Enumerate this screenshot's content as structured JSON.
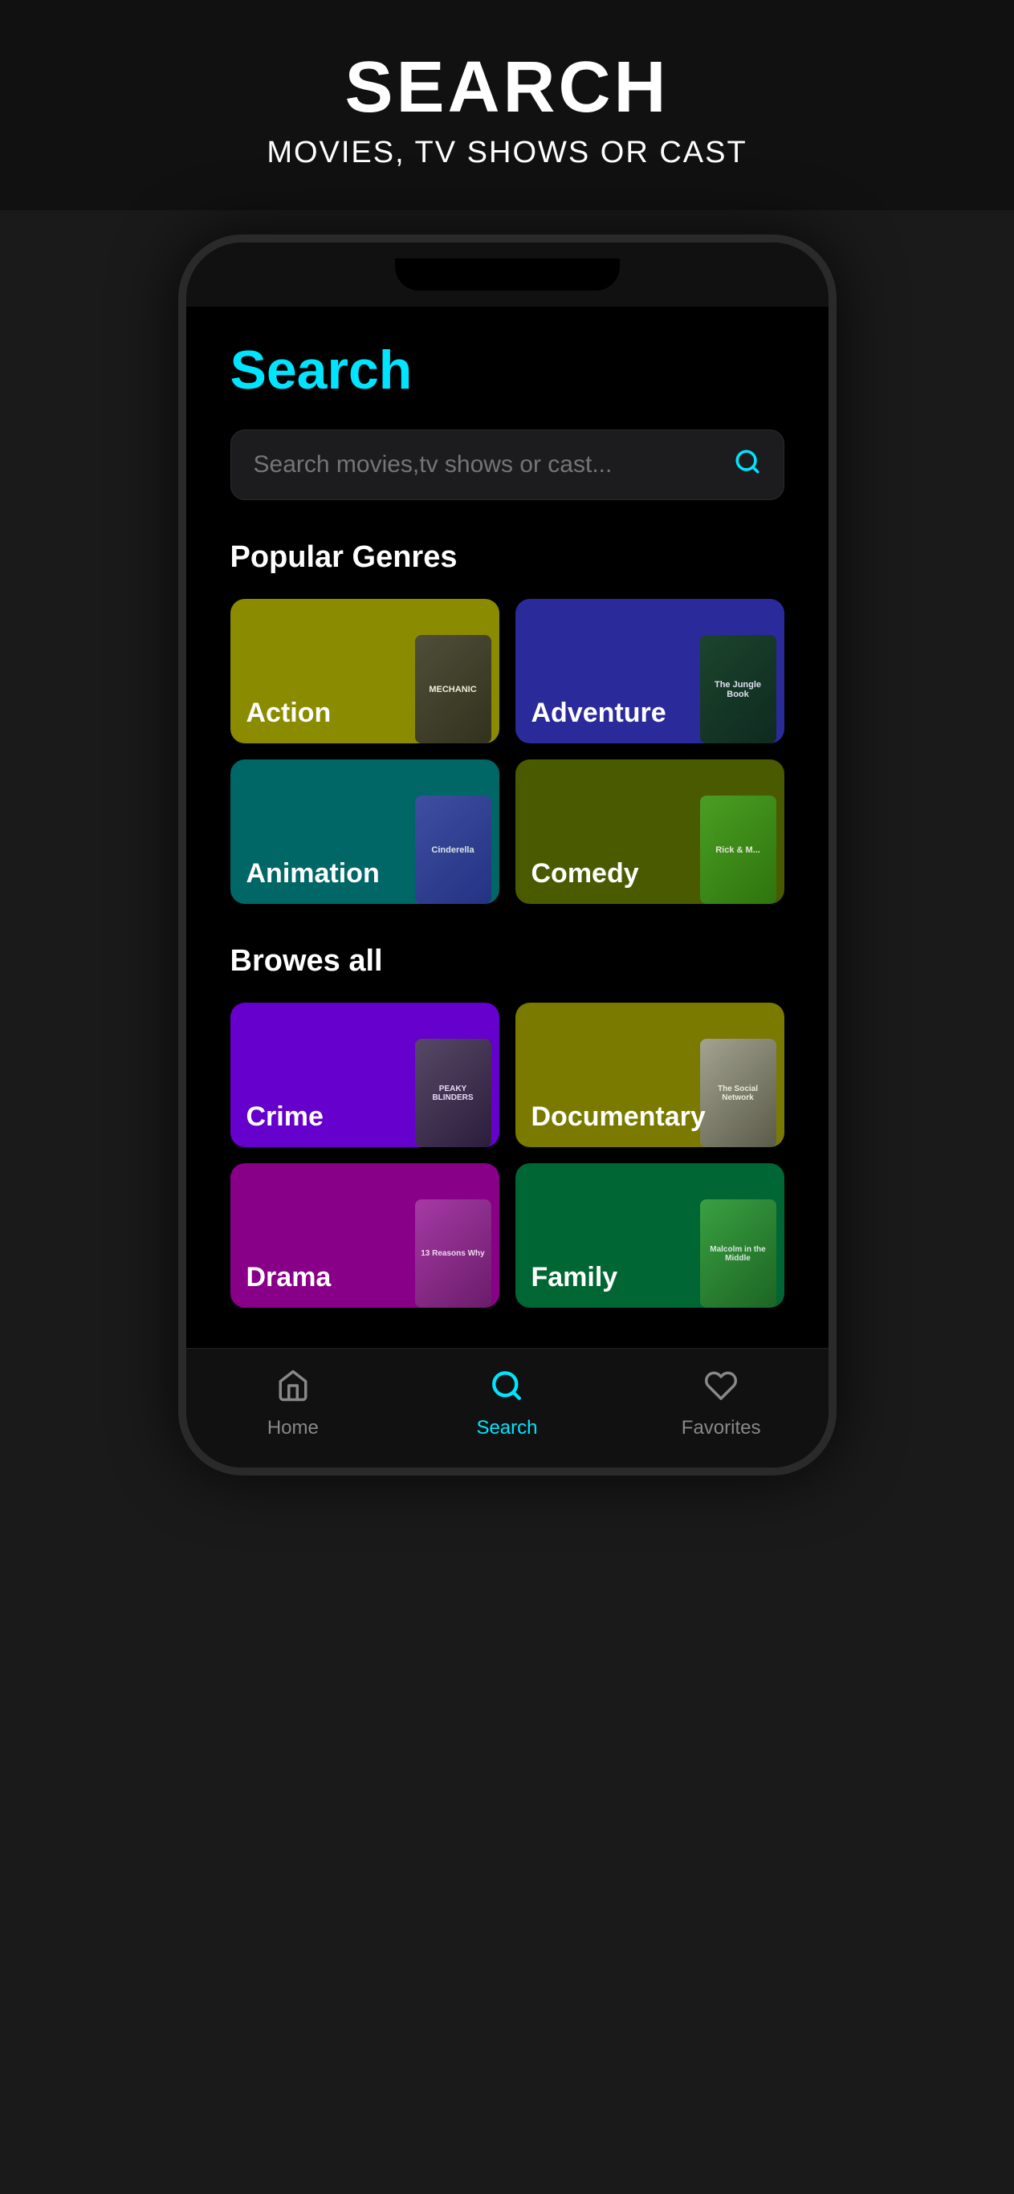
{
  "header": {
    "title": "SEARCH",
    "subtitle": "MOVIES, TV SHOWS OR CAST"
  },
  "screen": {
    "search_title": "Search",
    "search_placeholder": "Search movies,tv shows or cast...",
    "popular_genres_title": "Popular Genres",
    "browse_all_title": "Browes all",
    "genres_popular": [
      {
        "id": "action",
        "label": "Action",
        "color": "#7a7a00",
        "poster": "MECHANIC"
      },
      {
        "id": "adventure",
        "label": "Adventure",
        "color": "#2a2a9a",
        "poster": "The Jungle Book"
      },
      {
        "id": "animation",
        "label": "Animation",
        "color": "#006666",
        "poster": "Cinderella"
      },
      {
        "id": "comedy",
        "label": "Comedy",
        "color": "#4a5a00",
        "poster": "Rick & M..."
      }
    ],
    "genres_all": [
      {
        "id": "crime",
        "label": "Crime",
        "color": "#6600cc",
        "poster": "PEAKY BLINDERS"
      },
      {
        "id": "documentary",
        "label": "Documentary",
        "color": "#7a7a00",
        "poster": "The Social Network"
      },
      {
        "id": "drama",
        "label": "Drama",
        "color": "#880088",
        "poster": "13 Reasons Why"
      },
      {
        "id": "family",
        "label": "Family",
        "color": "#006633",
        "poster": "Malcolm in the Middle"
      }
    ]
  },
  "nav": {
    "items": [
      {
        "id": "home",
        "label": "Home",
        "active": false
      },
      {
        "id": "search",
        "label": "Search",
        "active": true
      },
      {
        "id": "favorites",
        "label": "Favorites",
        "active": false
      }
    ]
  }
}
